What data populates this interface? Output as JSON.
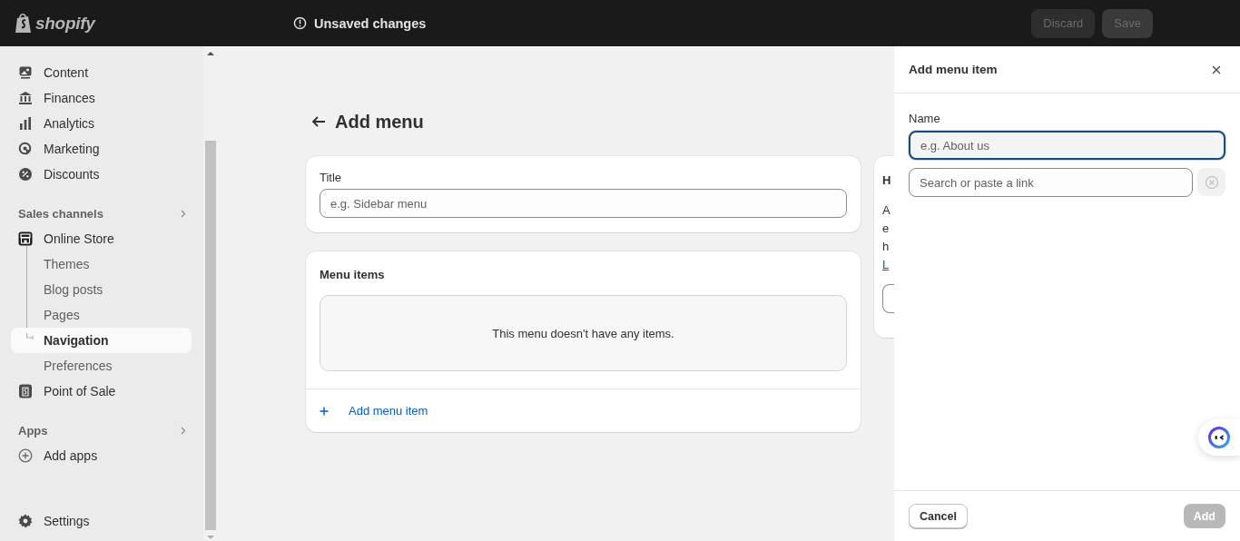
{
  "top_bar": {
    "logo": "shopify",
    "status": "Unsaved changes",
    "buttons": [
      {
        "label": "Discard",
        "disabled": true
      },
      {
        "label": "Save",
        "disabled": true
      }
    ]
  },
  "sidebar": {
    "main_items": [
      {
        "label": "Content"
      },
      {
        "label": "Finances"
      },
      {
        "label": "Analytics"
      },
      {
        "label": "Marketing"
      },
      {
        "label": "Discounts"
      }
    ],
    "sales_channels": {
      "heading": "Sales channels",
      "items": [
        {
          "label": "Online Store",
          "children": [
            {
              "label": "Themes",
              "selected": false
            },
            {
              "label": "Blog posts",
              "selected": false
            },
            {
              "label": "Pages",
              "selected": false
            },
            {
              "label": "Navigation",
              "selected": true
            },
            {
              "label": "Preferences",
              "selected": false
            }
          ]
        },
        {
          "label": "Point of Sale"
        }
      ]
    },
    "apps": {
      "heading": "Apps",
      "items": [
        {
          "label": "Add apps"
        }
      ]
    },
    "settings": {
      "label": "Settings"
    }
  },
  "page": {
    "title": "Add menu",
    "title_card": {
      "label": "Title",
      "placeholder": "e.g. Sidebar menu"
    },
    "menu_items_card": {
      "heading": "Menu items",
      "empty_text": "This menu doesn't have any items.",
      "add_link": "Add menu item"
    },
    "help_card": {
      "heading": "H",
      "lines": [
        "A",
        "e",
        "h"
      ],
      "link": "L"
    }
  },
  "panel": {
    "title": "Add menu item",
    "name_label": "Name",
    "name_placeholder": "e.g. About us",
    "link_placeholder": "Search or paste a link",
    "buttons": [
      {
        "label": "Cancel",
        "disabled": false
      },
      {
        "label": "Add",
        "disabled": true
      }
    ]
  }
}
